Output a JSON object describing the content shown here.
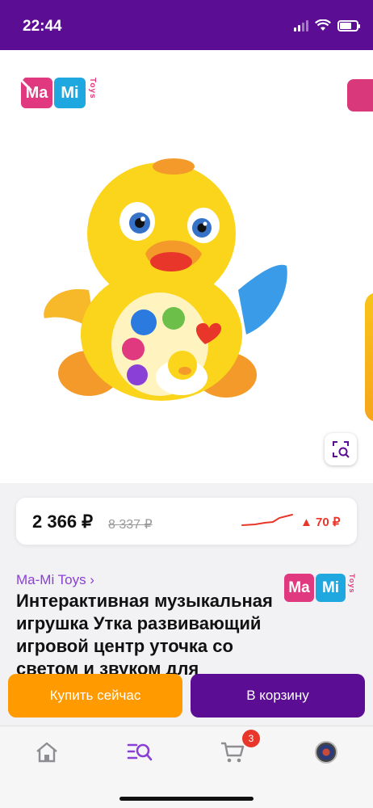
{
  "status_bar": {
    "time": "22:44"
  },
  "brand": {
    "logo_left": "Ma",
    "logo_right": "Mi",
    "logo_side": "Toys"
  },
  "price": {
    "current": "2 366 ₽",
    "old": "8 337 ₽",
    "change": "▲ 70 ₽"
  },
  "product": {
    "brand_link": "Ma-Mi Toys ›",
    "title": "Интерактивная музыкальная игрушка Утка развивающий игровой центр уточка со светом и звуком для малышей"
  },
  "actions": {
    "buy_now": "Купить сейчас",
    "add_to_cart": "В корзину"
  },
  "tab_bar": {
    "cart_count": "3"
  },
  "colors": {
    "primary": "#5b0d93",
    "accent": "#ff9a00",
    "price_up": "#e8362b",
    "brand_link": "#8a3fd6"
  },
  "icons": [
    "back-icon",
    "heart-icon",
    "share-icon",
    "visual-search-icon",
    "home-icon",
    "catalog-search-icon",
    "cart-icon",
    "profile-avatar"
  ]
}
